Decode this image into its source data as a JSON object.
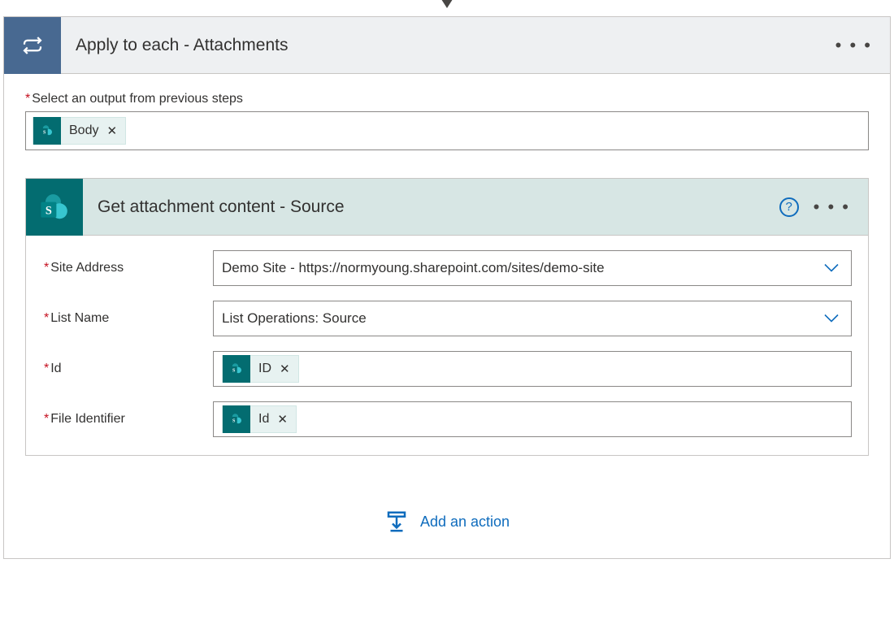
{
  "outer": {
    "title": "Apply to each - Attachments",
    "select_label": "Select an output from previous steps",
    "token_body": "Body"
  },
  "inner": {
    "title": "Get attachment content - Source",
    "params": {
      "site_address_label": "Site Address",
      "site_address_value": "Demo Site - https://normyoung.sharepoint.com/sites/demo-site",
      "list_name_label": "List Name",
      "list_name_value": "List Operations: Source",
      "id_label": "Id",
      "id_token": "ID",
      "file_identifier_label": "File Identifier",
      "file_identifier_token": "Id"
    }
  },
  "footer": {
    "add_action": "Add an action"
  }
}
